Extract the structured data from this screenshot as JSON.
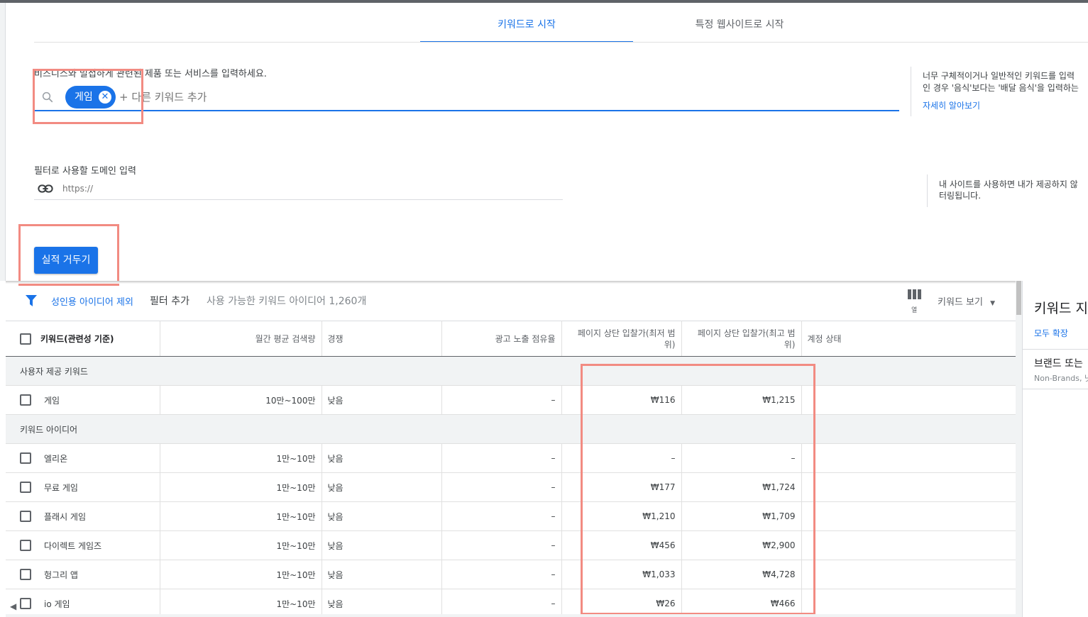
{
  "tabs": [
    {
      "label": "키워드로 시작",
      "active": true
    },
    {
      "label": "특정 웹사이트로 시작",
      "active": false
    }
  ],
  "keyword_section": {
    "prompt": "비즈니스와 밀접하게 관련된 제품 또는 서비스를 입력하세요.",
    "chip": "게임",
    "chip_remove": "✕",
    "add_placeholder": "+ 다른 키워드 추가",
    "hint_line1": "너무 구체적이거나 일반적인 키워드를 입력",
    "hint_line2": "인 경우 '음식'보다는 '배달 음식'을 입력하는",
    "learn_more": "자세히 알아보기"
  },
  "domain_section": {
    "label": "필터로 사용할 도메인 입력",
    "placeholder": "https://",
    "hint_line1": "내 사이트를 사용하면 내가 제공하지 않",
    "hint_line2": "터링됩니다."
  },
  "submit_label": "실적 거두기",
  "filter_bar": {
    "active_filter": "성인용 아이디어 제외",
    "add_filter": "필터 추가",
    "count_text": "사용 가능한 키워드 아이디어 1,260개",
    "columns_label": "열",
    "view_label": "키워드 보기",
    "view_caret": "▼"
  },
  "table": {
    "headers": [
      "키워드(관련성 기준)",
      "월간 평균 검색량",
      "경쟁",
      "광고 노출 점유율",
      "페이지 상단 입찰가(최저 범위)",
      "페이지 상단 입찰가(최고 범위)",
      "계정 상태"
    ],
    "group1": "사용자 제공 키워드",
    "group2": "키워드 아이디어",
    "rows": [
      {
        "kw": "게임",
        "vol": "10만~100만",
        "comp": "낮음",
        "share": "–",
        "low": "₩116",
        "high": "₩1,215"
      },
      {
        "kw": "엘리온",
        "vol": "1만~10만",
        "comp": "낮음",
        "share": "–",
        "low": "–",
        "high": "–"
      },
      {
        "kw": "무료 게임",
        "vol": "1만~10만",
        "comp": "낮음",
        "share": "–",
        "low": "₩177",
        "high": "₩1,724"
      },
      {
        "kw": "플래시 게임",
        "vol": "1만~10만",
        "comp": "낮음",
        "share": "–",
        "low": "₩1,210",
        "high": "₩1,709"
      },
      {
        "kw": "다이렉트 게임즈",
        "vol": "1만~10만",
        "comp": "낮음",
        "share": "–",
        "low": "₩456",
        "high": "₩2,900"
      },
      {
        "kw": "헝그리 앱",
        "vol": "1만~10만",
        "comp": "낮음",
        "share": "–",
        "low": "₩1,033",
        "high": "₩4,728"
      },
      {
        "kw": "io 게임",
        "vol": "1만~10만",
        "comp": "낮음",
        "share": "–",
        "low": "₩26",
        "high": "₩466"
      }
    ]
  },
  "right_panel": {
    "title": "키워드 지",
    "expand_all": "모두 확장",
    "brand": "브랜드 또는",
    "brand_sub": "Non-Brands, 넛"
  },
  "scroll_left": "◀",
  "colors": {
    "accent": "#1a73e8",
    "highlight": "#f28b82"
  }
}
